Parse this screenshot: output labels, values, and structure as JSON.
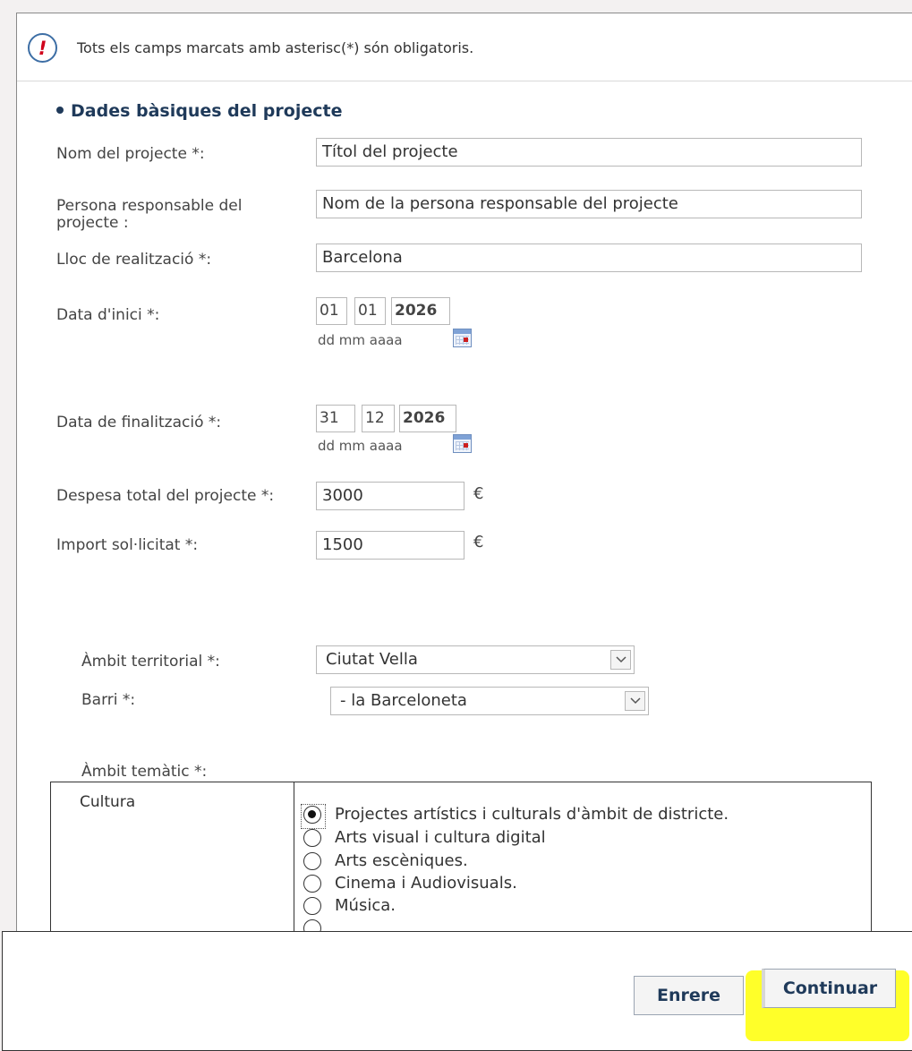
{
  "notice": {
    "text": "Tots els camps marcats amb asterisc(*) són obligatoris.",
    "icon": "exclamation-icon"
  },
  "section": {
    "title": "Dades bàsiques del projecte"
  },
  "fields": {
    "project_name": {
      "label": "Nom del projecte *:",
      "value": "Títol del projecte"
    },
    "responsible": {
      "label": "Persona responsable del projecte :",
      "value": "Nom de la persona responsable del projecte"
    },
    "location": {
      "label": "Lloc de realització *:",
      "value": "Barcelona"
    },
    "start_date": {
      "label": "Data d'inici *:",
      "day": "01",
      "month": "01",
      "year": "2026",
      "format": "dd mm aaaa"
    },
    "end_date": {
      "label": "Data de finalització *:",
      "day": "31",
      "month": "12",
      "year": "2026",
      "format": "dd mm aaaa"
    },
    "total_cost": {
      "label": "Despesa total del projecte *:",
      "value": "3000",
      "unit": "€"
    },
    "requested": {
      "label": "Import sol·licitat *:",
      "value": "1500",
      "unit": "€"
    },
    "territorial": {
      "label": "Àmbit territorial *:",
      "value": "Ciutat Vella"
    },
    "barri": {
      "label": "Barri *:",
      "value": "- la Barceloneta"
    },
    "thematic": {
      "label": "Àmbit temàtic *:"
    }
  },
  "theme": {
    "category": "Cultura",
    "options": [
      {
        "label": "Projectes artístics i culturals d'àmbit de districte.",
        "checked": true
      },
      {
        "label": "Arts visual i cultura digital",
        "checked": false
      },
      {
        "label": "Arts escèniques.",
        "checked": false
      },
      {
        "label": "Cinema i Audiovisuals.",
        "checked": false
      },
      {
        "label": "Música.",
        "checked": false
      }
    ]
  },
  "buttons": {
    "back": "Enrere",
    "continue": "Continuar"
  },
  "colors": {
    "highlight": "#ffff29",
    "heading": "#1f3a5a",
    "alert": "#d0021b"
  }
}
